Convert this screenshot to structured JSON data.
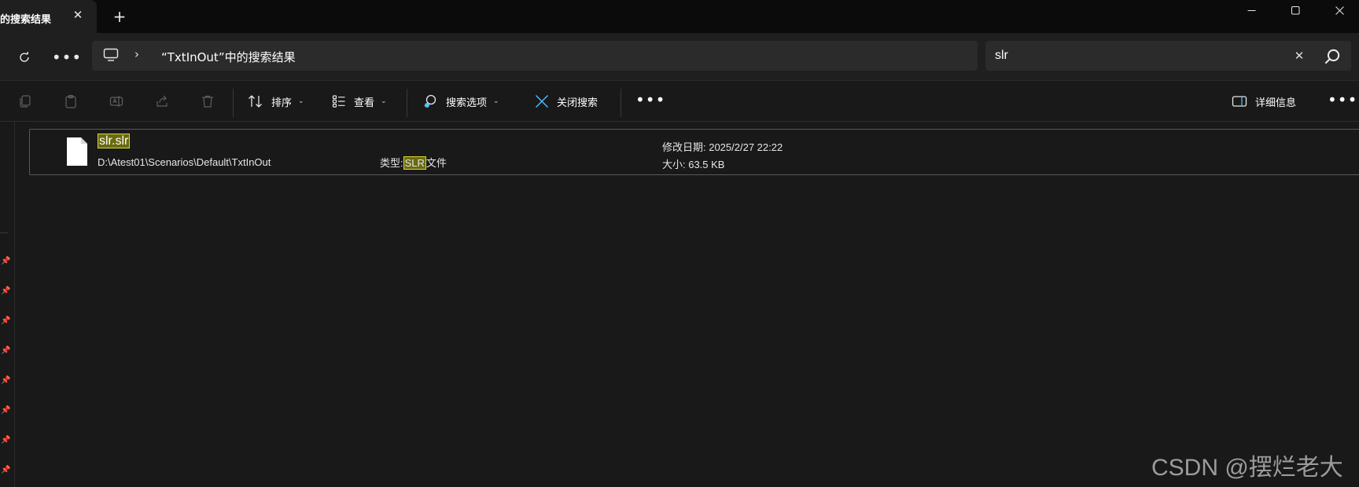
{
  "tab": {
    "title": "的搜索结果",
    "close_glyph": "✕",
    "new_tab_glyph": "+"
  },
  "window_controls": {
    "minimize": "minimize-icon",
    "maximize": "maximize-icon",
    "close": "close-icon"
  },
  "address_bar": {
    "more_glyph": "•••",
    "chevron": "›",
    "breadcrumb": "“TxtInOut”中的搜索结果"
  },
  "search": {
    "value": "slr",
    "clear_glyph": "✕"
  },
  "toolbar": {
    "sort_label": "排序",
    "view_label": "查看",
    "search_options_label": "搜索选项",
    "close_search_label": "关闭搜索",
    "more_glyph": "•••",
    "details_label": "详细信息",
    "caret": "⌄"
  },
  "result": {
    "file_name": "slr.slr",
    "path": "D:\\Atest01\\Scenarios\\Default\\TxtInOut",
    "type_prefix": "类型:",
    "type_highlight": "SLR",
    "type_suffix": "文件",
    "modified": "修改日期: 2025/2/27 22:22",
    "size": "大小: 63.5 KB"
  },
  "watermark": "CSDN @摆烂老大",
  "colors": {
    "accent": "#4cc2ff",
    "highlight_bg": "#6a6a10",
    "highlight_border": "#d8d83a"
  }
}
